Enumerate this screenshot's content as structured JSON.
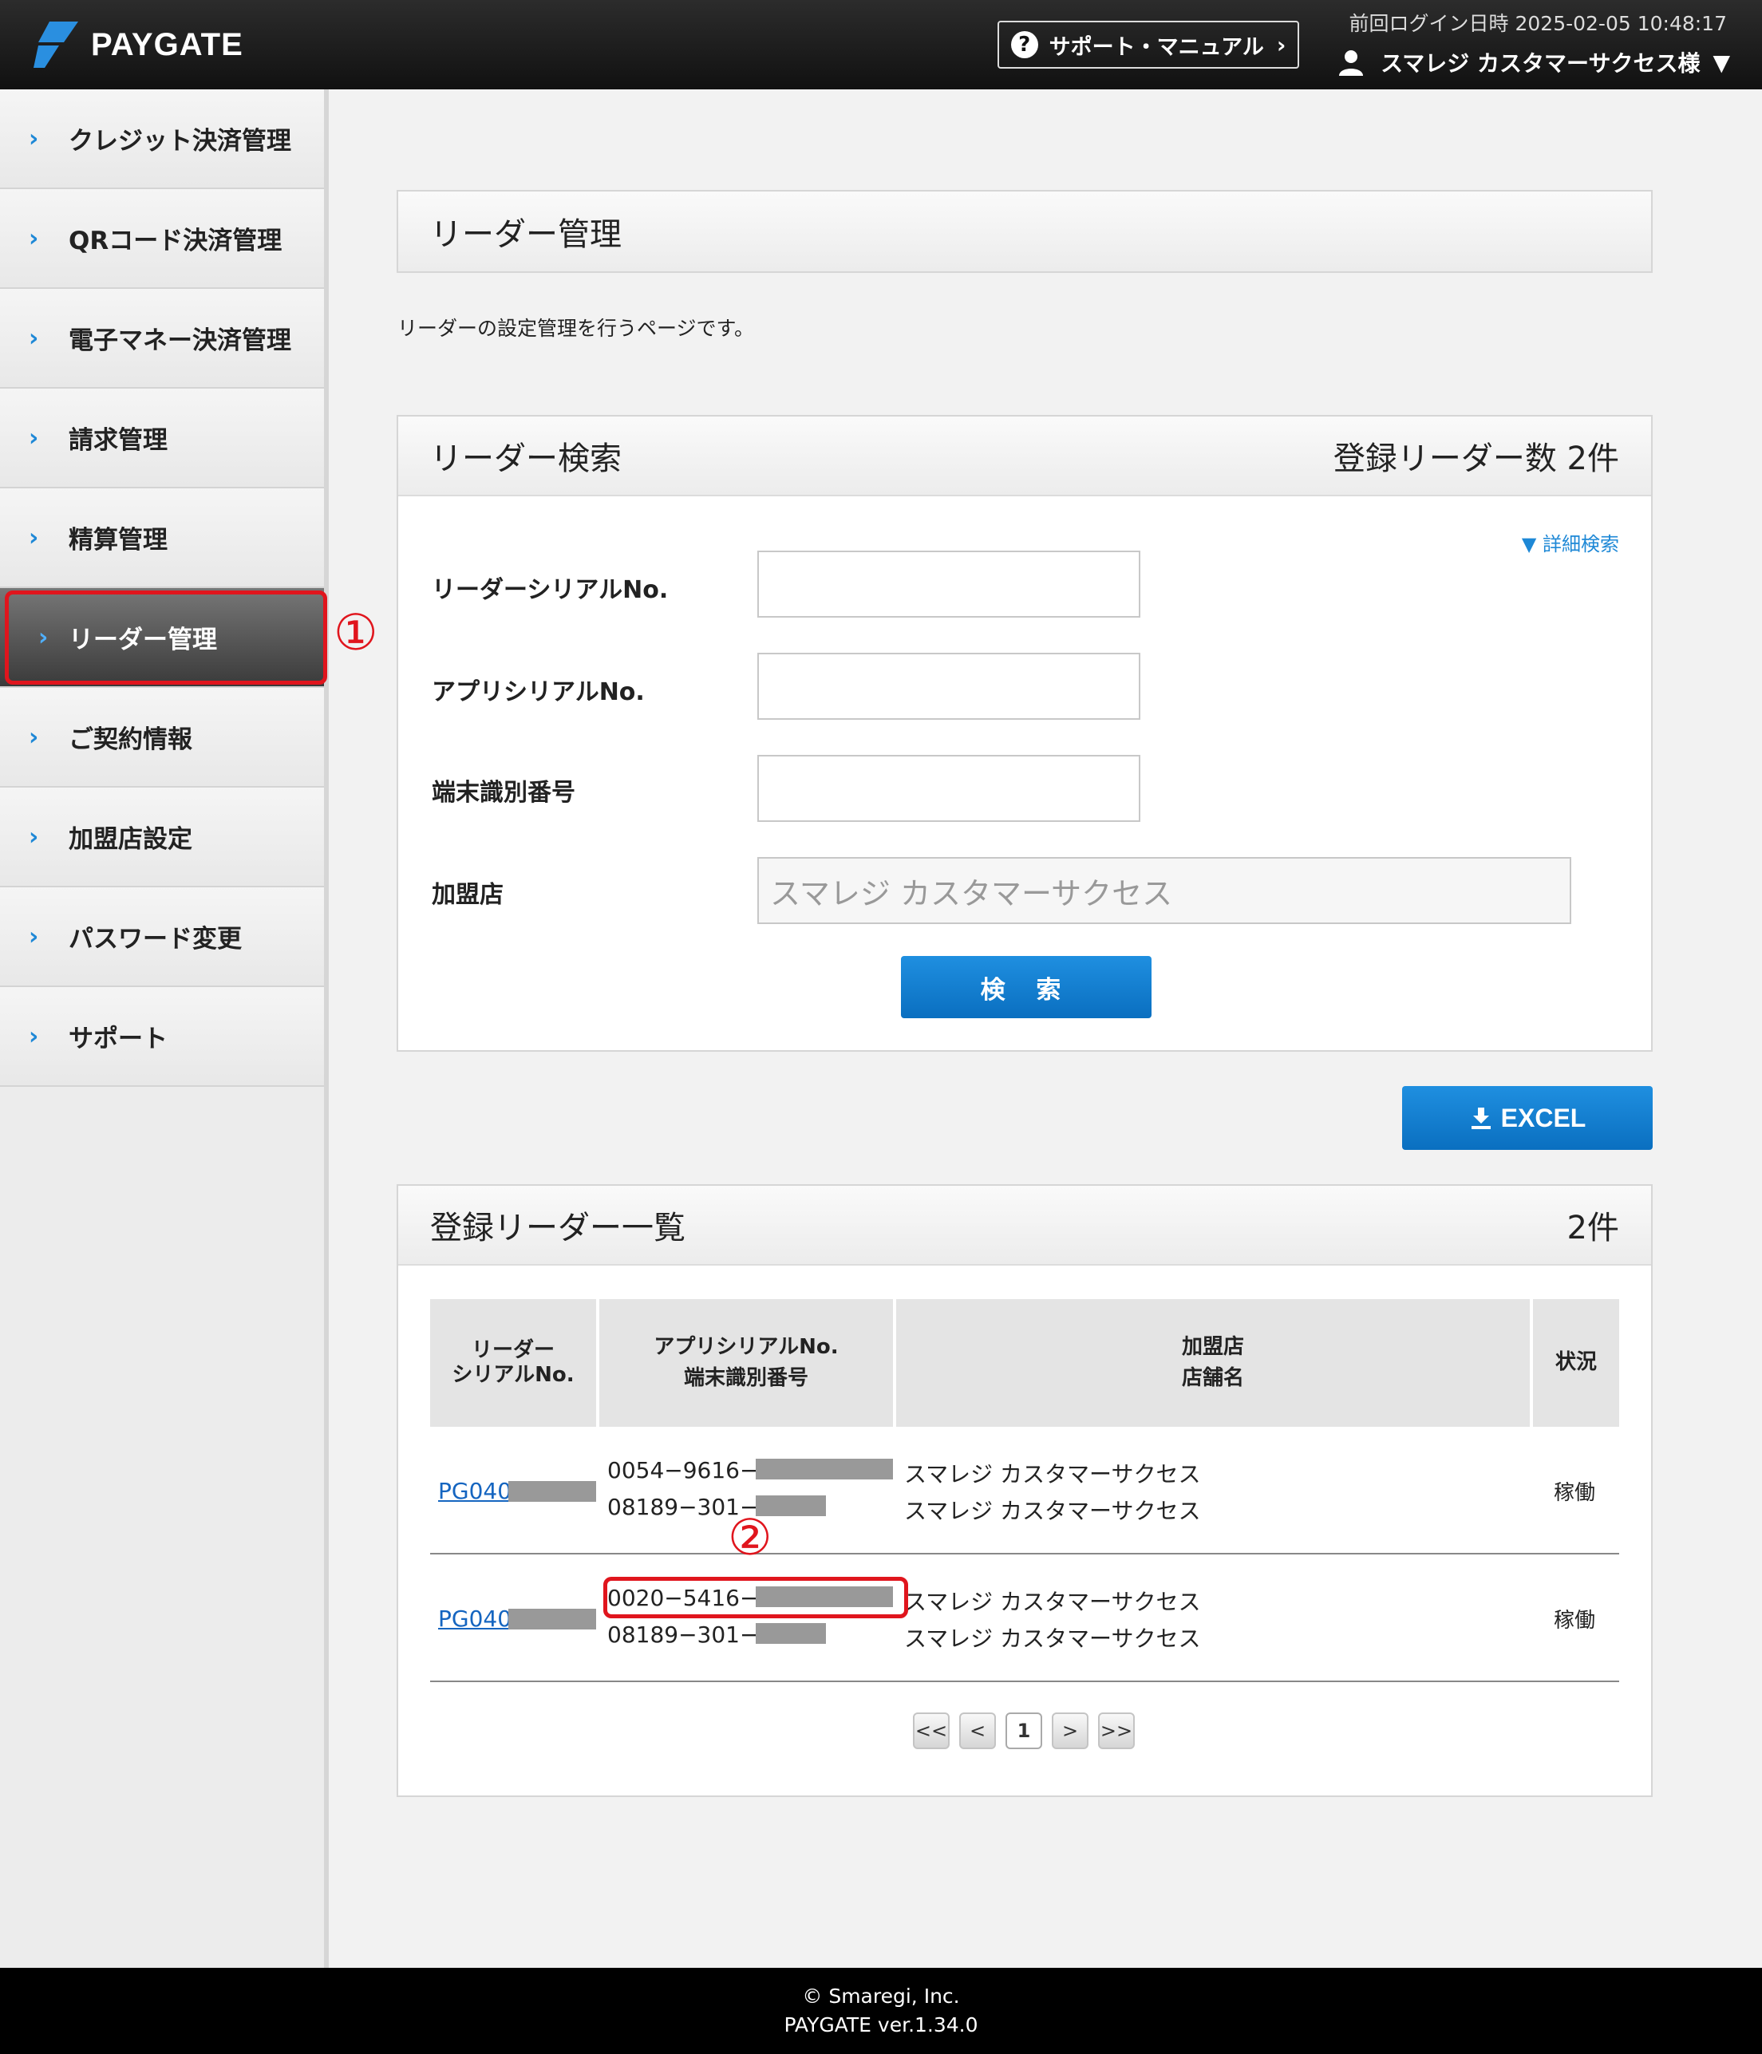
{
  "header": {
    "logo_text": "PAYGATE",
    "support_label": "サポート・マニュアル",
    "last_login": "前回ログイン日時 2025-02-05 10:48:17",
    "user_name": "スマレジ カスタマーサクセス様"
  },
  "sidebar": {
    "items": [
      {
        "label": "クレジット決済管理"
      },
      {
        "label": "QRコード決済管理"
      },
      {
        "label": "電子マネー決済管理"
      },
      {
        "label": "請求管理"
      },
      {
        "label": "精算管理"
      },
      {
        "label": "リーダー管理"
      },
      {
        "label": "ご契約情報"
      },
      {
        "label": "加盟店設定"
      },
      {
        "label": "パスワード変更"
      },
      {
        "label": "サポート"
      }
    ],
    "active_index": 5
  },
  "annotations": {
    "callout_1": "①",
    "callout_2": "②"
  },
  "page": {
    "title": "リーダー管理",
    "description": "リーダーの設定管理を行うページです。"
  },
  "search": {
    "title": "リーダー検索",
    "count_label": "登録リーダー数 2件",
    "detail_link": "▼ 詳細検索",
    "fields": {
      "reader_serial_label": "リーダーシリアルNo.",
      "app_serial_label": "アプリシリアルNo.",
      "terminal_id_label": "端末識別番号",
      "store_label": "加盟店",
      "store_value": "スマレジ カスタマーサクセス"
    },
    "button_label": "検 索"
  },
  "excel_label": "EXCEL",
  "list": {
    "title": "登録リーダー一覧",
    "count": "2件",
    "headers": {
      "reader_1": "リーダー",
      "reader_2": "シリアルNo.",
      "app_1": "アプリシリアルNo.",
      "app_2": "端末識別番号",
      "store_1": "加盟店",
      "store_2": "店舗名",
      "status": "状況"
    },
    "rows": [
      {
        "reader_serial": "PG040",
        "app_serial": "0054−9616−",
        "terminal_id": "08189−301−",
        "merchant": "スマレジ カスタマーサクセス",
        "store_name": "スマレジ カスタマーサクセス",
        "status": "稼働"
      },
      {
        "reader_serial": "PG040",
        "app_serial": "0020−5416−",
        "terminal_id": "08189−301−",
        "merchant": "スマレジ カスタマーサクセス",
        "store_name": "スマレジ カスタマーサクセス",
        "status": "稼働"
      }
    ]
  },
  "pagination": {
    "first": "<<",
    "prev": "<",
    "current": "1",
    "next": ">",
    "last": ">>"
  },
  "footer": {
    "copyright": "© Smaregi, Inc.",
    "version": "PAYGATE ver.1.34.0"
  }
}
